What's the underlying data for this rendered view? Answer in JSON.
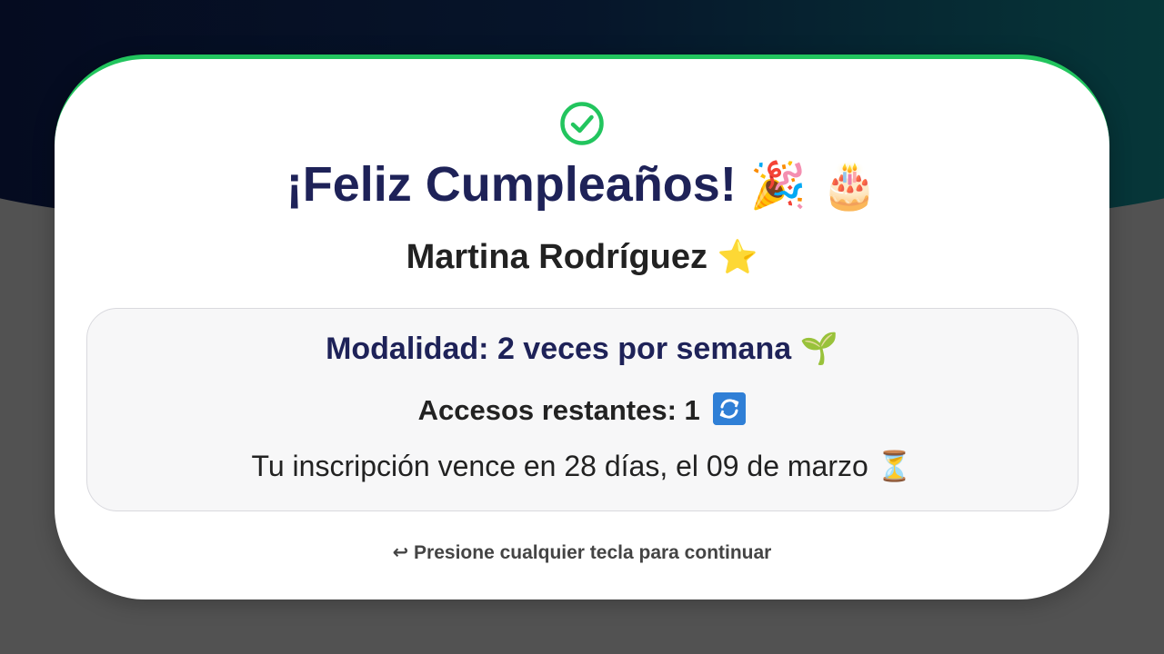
{
  "colors": {
    "accent_green": "#22c55e",
    "title_navy": "#1e2258",
    "card_bg": "#ffffff",
    "info_box_bg": "#f7f7f8",
    "page_bg": "#525252"
  },
  "icons": {
    "status": "check-circle-icon",
    "title_1": "party-popper-icon",
    "title_2": "birthday-cake-icon",
    "name": "star-icon",
    "modalidad": "seedling-icon",
    "accesos": "refresh-icon",
    "vence": "hourglass-icon",
    "hint": "return-arrow-icon"
  },
  "greeting": {
    "title": "¡Feliz Cumpleaños!",
    "title_emojis": "🎉 🎂",
    "member_name": "Martina Rodríguez",
    "name_emoji": "⭐"
  },
  "membership": {
    "modalidad": "Modalidad: 2 veces por semana",
    "modalidad_emoji": "🌱",
    "accesos": "Accesos restantes: 1",
    "vence": "Tu inscripción vence en 28 días, el 09 de marzo",
    "vence_emoji": "⏳"
  },
  "footer": {
    "hint": "↩ Presione cualquier tecla para continuar"
  }
}
